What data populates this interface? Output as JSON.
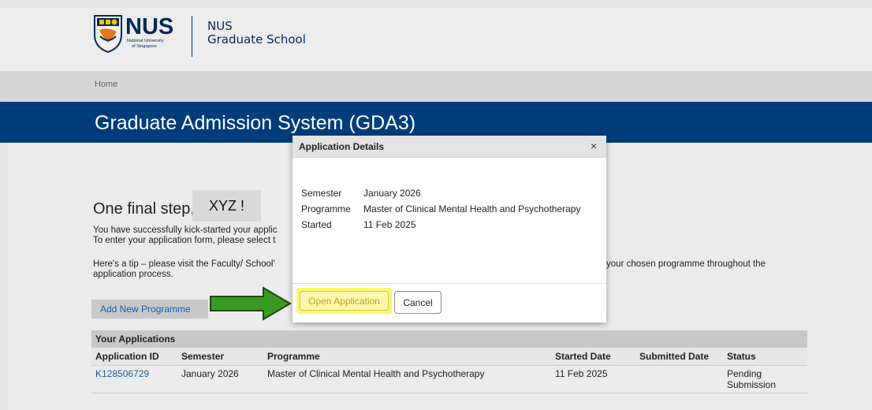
{
  "header": {
    "logo_name": "NUS",
    "logo_subtitle_line1": "National University",
    "logo_subtitle_line2": "of Singapore",
    "school_line1": "NUS",
    "school_line2": "Graduate School"
  },
  "breadcrumb": {
    "home": "Home"
  },
  "page_title": "Graduate Admission System (GDA3)",
  "main": {
    "greeting": "One final step,",
    "name_badge": "XYZ !",
    "line1": "You have successfully kick-started your applic",
    "line2": "To enter your application form, please select t",
    "tip_line1_left": "Here's a tip – please visit the Faculty/ School'",
    "tip_line1_right": "your chosen programme throughout the",
    "tip_line2": "application process.",
    "add_button": "Add New Programme"
  },
  "applications_table": {
    "caption": "Your Applications",
    "columns": [
      "Application ID",
      "Semester",
      "Programme",
      "Started Date",
      "Submitted Date",
      "Status"
    ],
    "rows": [
      {
        "application_id": "K128506729",
        "semester": "January 2026",
        "programme": "Master of Clinical Mental Health and Psychotherapy",
        "started_date": "11 Feb 2025",
        "submitted_date": "",
        "status_line1": "Pending",
        "status_line2": "Submission"
      }
    ]
  },
  "modal": {
    "title": "Application Details",
    "close_icon": "close-icon",
    "close_glyph": "×",
    "fields": [
      {
        "label": "Semester",
        "value": "January 2026"
      },
      {
        "label": "Programme",
        "value": "Master of Clinical Mental Health and Psychotherapy"
      },
      {
        "label": "Started",
        "value": "11 Feb 2025"
      }
    ],
    "open_button": "Open Application",
    "cancel_button": "Cancel"
  },
  "colors": {
    "brand_blue": "#003d7c",
    "link_blue": "#1a5fa0",
    "highlight_yellow": "#faf76a",
    "arrow_green": "#3a9a22"
  }
}
